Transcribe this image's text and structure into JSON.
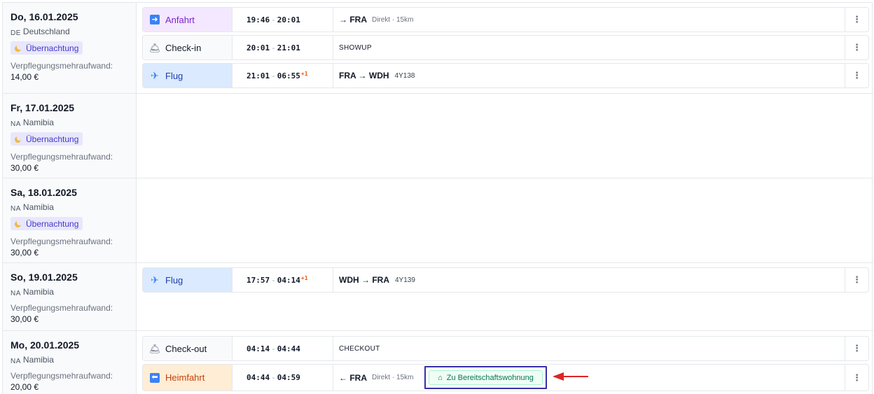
{
  "days": [
    {
      "date": "Do, 16.01.2025",
      "country_code": "DE",
      "country": "Deutschland",
      "badge": "Übernachtung",
      "meal_label": "Verpflegungsmehraufwand:",
      "meal_value": "14,00 €",
      "segments": [
        {
          "type": "Anfahrt",
          "time_from": "19:46",
          "time_to": "20:01",
          "plus": "",
          "route": "→ FRA",
          "sub": "Direkt · 15km"
        },
        {
          "type": "Check-in",
          "time_from": "20:01",
          "time_to": "21:01",
          "plus": "",
          "code": "SHOWUP"
        },
        {
          "type": "Flug",
          "time_from": "21:01",
          "time_to": "06:55",
          "plus": "+1",
          "route": "FRA → WDH",
          "flight_no": "4Y138"
        }
      ]
    },
    {
      "date": "Fr, 17.01.2025",
      "country_code": "NA",
      "country": "Namibia",
      "badge": "Übernachtung",
      "meal_label": "Verpflegungsmehraufwand:",
      "meal_value": "30,00 €"
    },
    {
      "date": "Sa, 18.01.2025",
      "country_code": "NA",
      "country": "Namibia",
      "badge": "Übernachtung",
      "meal_label": "Verpflegungsmehraufwand:",
      "meal_value": "30,00 €"
    },
    {
      "date": "So, 19.01.2025",
      "country_code": "NA",
      "country": "Namibia",
      "meal_label": "Verpflegungsmehraufwand:",
      "meal_value": "30,00 €",
      "segments": [
        {
          "type": "Flug",
          "time_from": "17:57",
          "time_to": "04:14",
          "plus": "+1",
          "route": "WDH → FRA",
          "flight_no": "4Y139"
        }
      ]
    },
    {
      "date": "Mo, 20.01.2025",
      "country_code": "NA",
      "country": "Namibia",
      "meal_label": "Verpflegungsmehraufwand:",
      "meal_value": "20,00 €",
      "segments": [
        {
          "type": "Check-out",
          "time_from": "04:14",
          "time_to": "04:44",
          "plus": "",
          "code": "CHECKOUT"
        },
        {
          "type": "Heimfahrt",
          "time_from": "04:44",
          "time_to": "04:59",
          "plus": "",
          "route": "← FRA",
          "sub": "Direkt · 15km",
          "button": "Zu Bereitschaftswohnung"
        }
      ]
    }
  ],
  "menu_glyph": "⋮",
  "time_sep": "-",
  "colors": {
    "anfahrt": "#7e22ce",
    "flug": "#1e40af",
    "heimfahrt": "#c2410c",
    "badge": "#4338ca",
    "highlight_border": "#3730a3",
    "annotation_arrow": "#dc2626"
  }
}
